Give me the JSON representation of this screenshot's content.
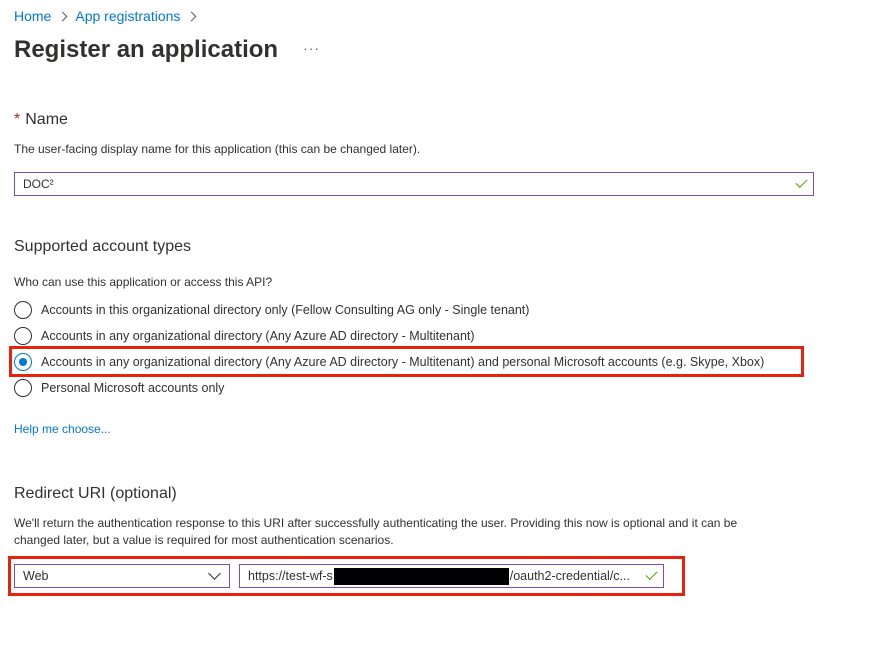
{
  "breadcrumb": {
    "home": "Home",
    "app_registrations": "App registrations"
  },
  "page": {
    "title": "Register an application",
    "more": "···"
  },
  "name_section": {
    "required_marker": "*",
    "heading": "Name",
    "description": "The user-facing display name for this application (this can be changed later).",
    "value": "DOC²"
  },
  "account_types": {
    "heading": "Supported account types",
    "question": "Who can use this application or access this API?",
    "options": [
      {
        "label": "Accounts in this organizational directory only (Fellow Consulting AG only - Single tenant)",
        "selected": false
      },
      {
        "label": "Accounts in any organizational directory (Any Azure AD directory - Multitenant)",
        "selected": false
      },
      {
        "label": "Accounts in any organizational directory (Any Azure AD directory - Multitenant) and personal Microsoft accounts (e.g. Skype, Xbox)",
        "selected": true
      },
      {
        "label": "Personal Microsoft accounts only",
        "selected": false
      }
    ],
    "help_link": "Help me choose..."
  },
  "redirect": {
    "heading": "Redirect URI (optional)",
    "description_line1": "We'll return the authentication response to this URI after successfully authenticating the user. Providing this now is optional and it can be",
    "description_line2": "changed later, but a value is required for most authentication scenarios.",
    "platform": "Web",
    "uri_prefix": "https://test-wf-s",
    "uri_suffix": "/oauth2-credential/c..."
  },
  "colors": {
    "link": "#0078d4",
    "annotation_red": "#e8230d",
    "input_border": "#8a4ba8",
    "valid_check": "#57a300"
  },
  "icons": [
    "chevron-right-icon",
    "more-icon",
    "check-icon",
    "radio-icon",
    "chevron-down-icon"
  ]
}
